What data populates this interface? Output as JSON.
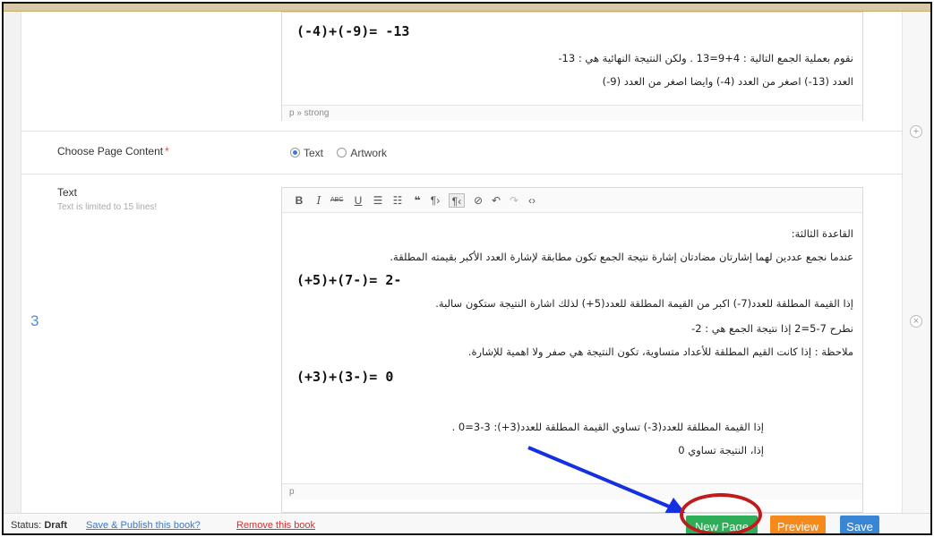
{
  "prev_row": {
    "math_line": "(-4)+(-9)=  -13",
    "line1": "نقوم بعملية الجمع التالية :  4+9=13 . ولكن النتيجة النهائية هي : 13-",
    "line2": "العدد (13-) اصغر من العدد (4-) وايضا اصغر من العدد (9-)",
    "path": "p » strong"
  },
  "choose_content": {
    "label": "Choose Page Content",
    "required_mark": "*",
    "options": [
      {
        "label": "Text",
        "selected": true
      },
      {
        "label": "Artwork",
        "selected": false
      }
    ]
  },
  "text_field": {
    "label": "Text",
    "hint": "Text is limited to 15 lines!",
    "row_number": "3",
    "toolbar": [
      "B",
      "I",
      "ABC",
      "U",
      "☰",
      "☷",
      "❝",
      "¶›",
      "¶‹",
      "⊘",
      "↶",
      "↷",
      "‹›"
    ],
    "content": {
      "heading": "القاعدة الثالثة:",
      "line1": "عندما نجمع عددين لهما إشارتان مضادتان إشارة نتيجة الجمع تكون مطابقة لإشارة العدد الأكبر بقيمته المطلقة.",
      "math1": "(+5)+(7-)= 2-",
      "line2": "إذا القيمة المطلقة للعدد(7-) اكبر من القيمة المطلقة للعدد(5+) لذلك اشارة النتيجة ستكون سالبة.",
      "line3": "نطرح   7-5=2     إذا نتيجة الجمع هي : 2-",
      "line4": "ملاحظة : إذا كانت القيم المطلقة للأعداد متساوية، تكون النتيجة هي صفر ولا اهمية للإشارة.",
      "math2": "(+3)+(3-)= 0",
      "line5": "إذا القيمة المطلقة للعدد(3-) تساوي القيمة المطلقة للعدد(3+): 3-3=0  .",
      "line6": "إذا، النتيجة تساوي 0"
    },
    "path": "p"
  },
  "controls": {
    "add_icon": "plus-icon",
    "remove_icon": "close-icon"
  },
  "status_bar": {
    "status_label": "Status:",
    "status_value": "Draft",
    "publish_link": "Save & Publish this book?",
    "remove_link": "Remove this book",
    "new_page": "New Page",
    "preview": "Preview",
    "save": "Save"
  },
  "colors": {
    "accent_blue": "#3a86d6",
    "green": "#2eae58",
    "orange": "#f48a1c",
    "annotation_red": "#c01c1c",
    "annotation_arrow": "#1530e0"
  }
}
